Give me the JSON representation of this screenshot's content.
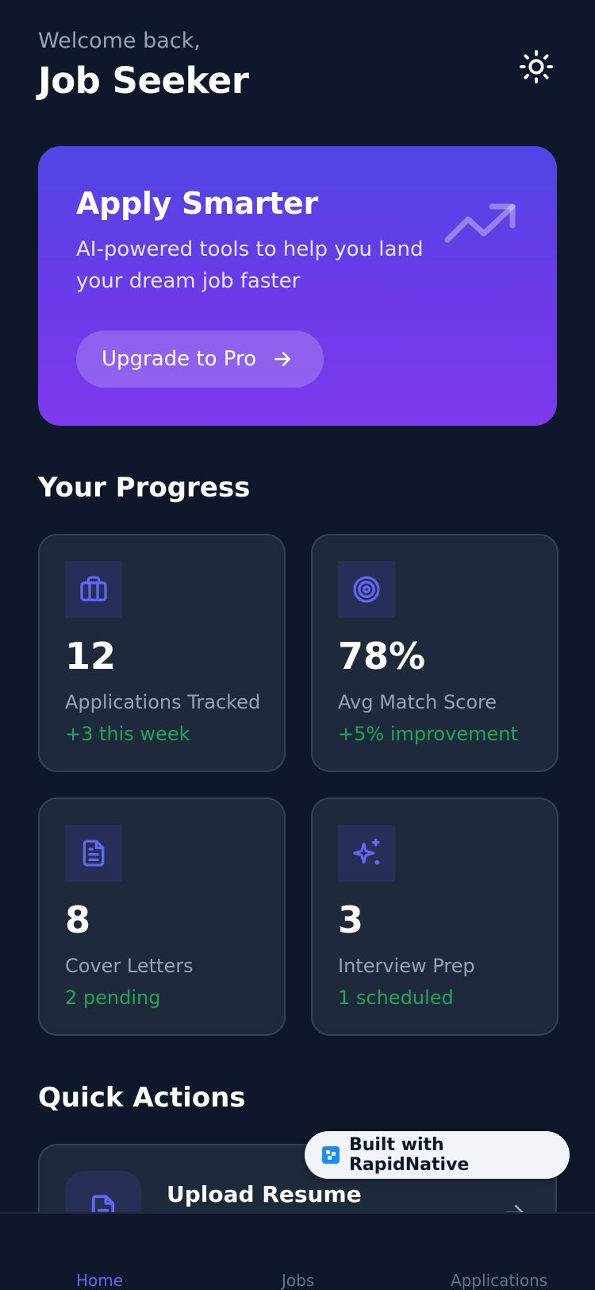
{
  "header": {
    "welcome": "Welcome back,",
    "user_name": "Job Seeker"
  },
  "promo": {
    "title": "Apply Smarter",
    "subtitle": "AI-powered tools to help you land your dream job faster",
    "button_label": "Upgrade to Pro"
  },
  "progress": {
    "title": "Your Progress",
    "cards": [
      {
        "icon": "briefcase-icon",
        "value": "12",
        "label": "Applications Tracked",
        "note": "+3 this week"
      },
      {
        "icon": "target-icon",
        "value": "78%",
        "label": "Avg Match Score",
        "note": "+5% improvement"
      },
      {
        "icon": "document-icon",
        "value": "8",
        "label": "Cover Letters",
        "note": "2 pending"
      },
      {
        "icon": "sparkles-icon",
        "value": "3",
        "label": "Interview Prep",
        "note": "1 scheduled"
      }
    ]
  },
  "quick_actions": {
    "title": "Quick Actions",
    "items": [
      {
        "icon": "upload-document-icon",
        "label": "Upload Resume"
      }
    ]
  },
  "badge": {
    "label": "Built with RapidNative"
  },
  "nav": {
    "items": [
      {
        "label": "Home",
        "active": true
      },
      {
        "label": "Jobs",
        "active": false
      },
      {
        "label": "Applications",
        "active": false
      }
    ]
  },
  "colors": {
    "background": "#0f172a",
    "card": "#1e293b",
    "accent": "#6366f1",
    "positive": "#22a55a",
    "muted": "#94a3b8"
  }
}
